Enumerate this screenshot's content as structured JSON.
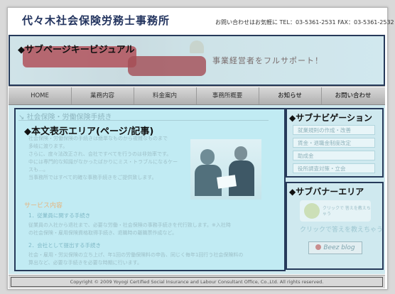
{
  "header": {
    "site_title": "代々木社会保険労務士事務所",
    "contact": "お問い合わせはお気軽に TEL：03-5361-2531 FAX：03-5361-2532"
  },
  "main_visual": {
    "label": "◆サブページキービジュアル",
    "catchphrase": "事業経営者をフルサポート！"
  },
  "nav": {
    "items": [
      {
        "label": "HOME"
      },
      {
        "label": "業務内容"
      },
      {
        "label": "料金案内"
      },
      {
        "label": "事務所概要"
      },
      {
        "label": "お知らせ"
      },
      {
        "label": "お問い合わせ"
      }
    ]
  },
  "content": {
    "heading": "社会保険・労働保険手続き",
    "area_label": "◆本文表示エリア(ページ/記事)",
    "intro_lines": [
      "社会保険・労働保険の手続きは簡単なものから複雑なものまで",
      "多岐に渡ります。",
      "さらに、度々法改正され、会社ですべてを行うのは非効率です。",
      "中には専門的な知識がなかったばかりにミス・トラブルになるケー",
      "スも…。",
      "当事務所ではすべて的確な事務手続きをご提供致します。"
    ],
    "service_title": "サービス内容",
    "sections": [
      {
        "title": "1．従業員に関する手続き",
        "lines": [
          "従業員の入社から退社まで、必要な労働・社会保険の事務手続きを代行致します。※入社時",
          "の社会保険・雇用保険資格取得手続き、退職時の離職票作成など。"
        ]
      },
      {
        "title": "2．会社として提出する手続き",
        "lines": [
          "社会・雇用・労災保険の立ち上げ、年1回の労働保険料の申告、同じく毎年1回行う社会保険料の",
          "算出など、必要な手続きを必要な時期に行います。"
        ]
      }
    ]
  },
  "subnav": {
    "label": "◆サブナビゲーション",
    "items": [
      {
        "label": "就業規則の作成・改善"
      },
      {
        "label": "賃金・退職金制度改定"
      },
      {
        "label": "助成金"
      },
      {
        "label": "役所調査対策・立会"
      }
    ]
  },
  "subbanner": {
    "label": "◆サブバナーエリア",
    "banner_text": "クリックで 答えを教えちゃう",
    "caption": "クリックで答えを教えちゃう",
    "blog_label": "Beez blog"
  },
  "footer": {
    "copyright": "Copyright © 2009 Yoyogi Certified Social Insurance and Labour Consultant Office, Co.,Ltd. All rights reserved."
  }
}
